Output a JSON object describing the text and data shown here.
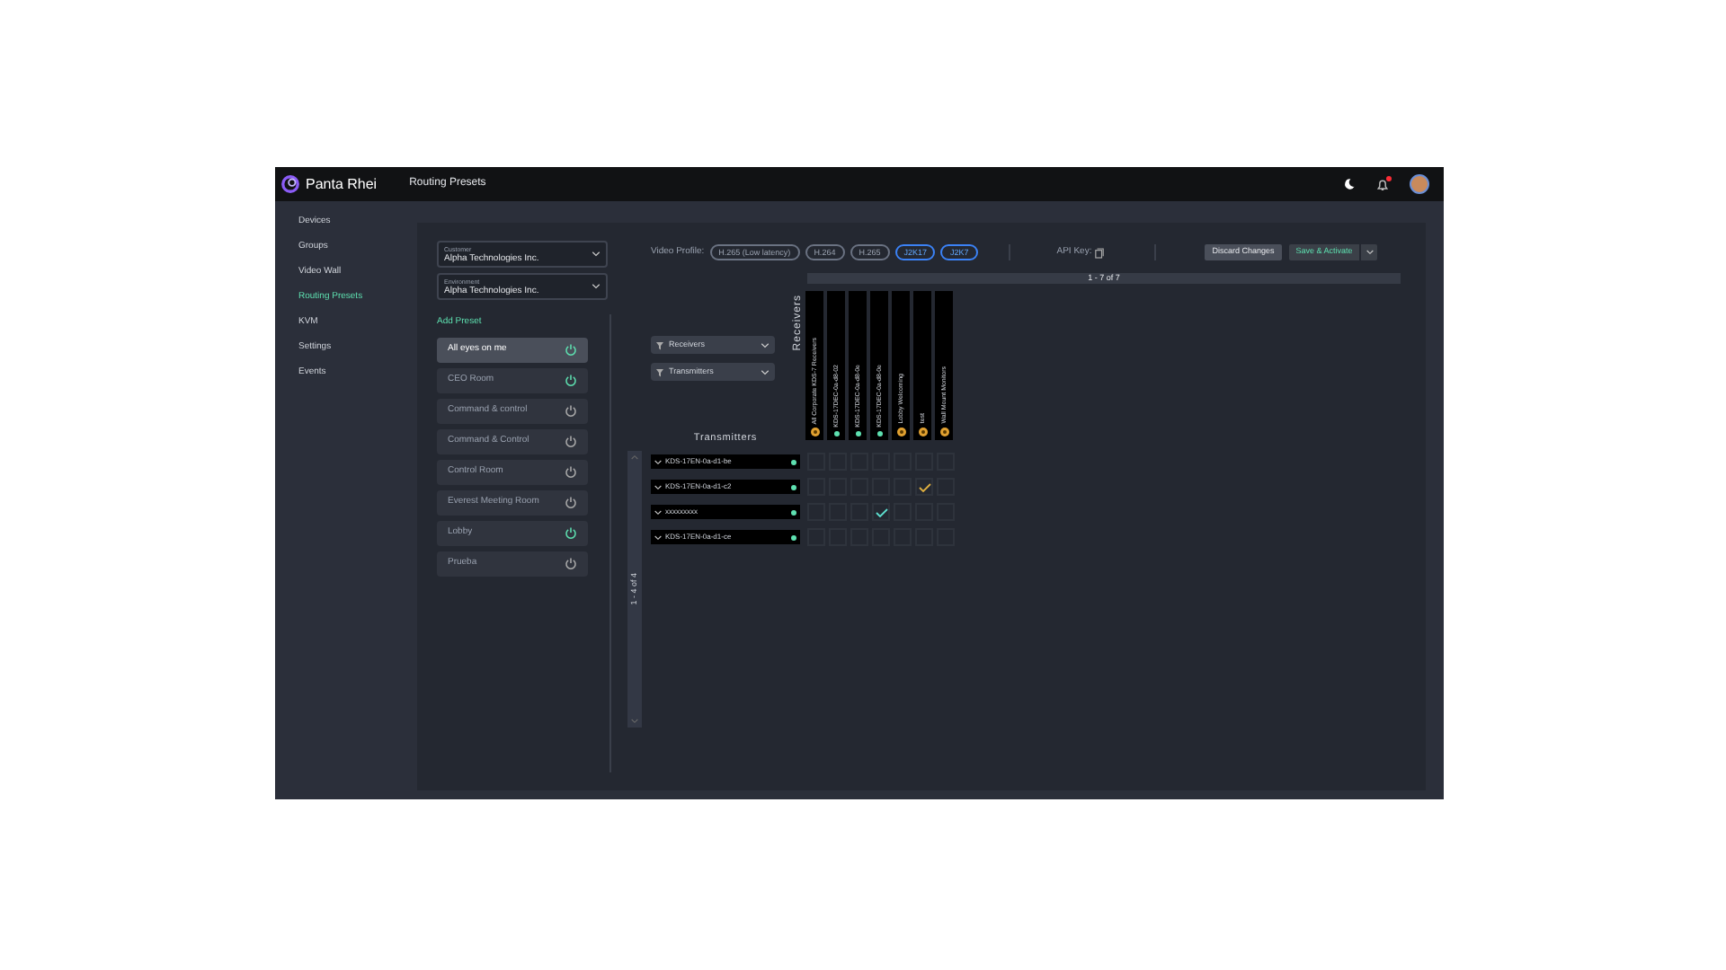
{
  "app": {
    "logo": "Panta Rhei",
    "page_title": "Routing Presets",
    "notification_unread": true
  },
  "sidebar": {
    "items": [
      {
        "label": "Devices",
        "selected": false
      },
      {
        "label": "Groups",
        "selected": false
      },
      {
        "label": "Video Wall",
        "selected": false
      },
      {
        "label": "Routing Presets",
        "selected": true
      },
      {
        "label": "KVM",
        "selected": false
      },
      {
        "label": "Settings",
        "selected": false
      },
      {
        "label": "Events",
        "selected": false
      }
    ]
  },
  "customer": {
    "label": "Customer",
    "value": "Alpha Technologies Inc."
  },
  "environment": {
    "label": "Environment",
    "value": "Alpha Technologies Inc."
  },
  "add_preset": "Add Preset",
  "presets": [
    {
      "name": "All eyes on me",
      "selected": true,
      "active": true
    },
    {
      "name": "CEO Room",
      "selected": false,
      "active": true
    },
    {
      "name": "Command & control",
      "selected": false,
      "active": false
    },
    {
      "name": "Command & Control",
      "selected": false,
      "active": false
    },
    {
      "name": "Control Room",
      "selected": false,
      "active": false
    },
    {
      "name": "Everest Meeting Room",
      "selected": false,
      "active": false
    },
    {
      "name": "Lobby",
      "selected": false,
      "active": true
    },
    {
      "name": "Prueba",
      "selected": false,
      "active": false
    }
  ],
  "video_profile": {
    "label": "Video Profile:",
    "options": [
      {
        "label": "H.265 (Low latency)",
        "selected": false
      },
      {
        "label": "H.264",
        "selected": false
      },
      {
        "label": "H.265",
        "selected": false
      },
      {
        "label": "J2K17",
        "selected": true
      },
      {
        "label": "J2K7",
        "selected": true
      }
    ]
  },
  "api_key": "API Key:",
  "buttons": {
    "discard": "Discard Changes",
    "save": "Save & Activate"
  },
  "receivers_pager": "1 - 7 of 7",
  "filters": [
    "Receivers",
    "Transmitters"
  ],
  "receivers_title": "Receivers",
  "receivers": [
    {
      "name": "All Corporate KDS-7 Receivers",
      "kind": "group"
    },
    {
      "name": "KDS-17DEC-0a-d8-02",
      "kind": "device"
    },
    {
      "name": "KDS-17DEC-0a-d8-0e",
      "kind": "device"
    },
    {
      "name": "KDS-17DEC-0a-d8-0e",
      "kind": "device"
    },
    {
      "name": "Lobby Welcoming",
      "kind": "group"
    },
    {
      "name": "test",
      "kind": "group"
    },
    {
      "name": "Wall Mount Monitors",
      "kind": "group"
    }
  ],
  "transmitters_title": "Transmitters",
  "transmitters_pager": "1 - 4 of 4",
  "transmitters": [
    {
      "name": "KDS-17EN-0a-d1-be",
      "routes": [
        false,
        false,
        false,
        false,
        false,
        false,
        false
      ]
    },
    {
      "name": "KDS-17EN-0a-d1-c2",
      "routes": [
        false,
        false,
        false,
        false,
        false,
        true,
        false
      ]
    },
    {
      "name": "xxxxxxxxx",
      "routes": [
        false,
        false,
        false,
        true,
        false,
        false,
        false
      ]
    },
    {
      "name": "KDS-17EN-0a-d1-ce",
      "routes": [
        false,
        false,
        false,
        false,
        false,
        false,
        false
      ]
    }
  ]
}
